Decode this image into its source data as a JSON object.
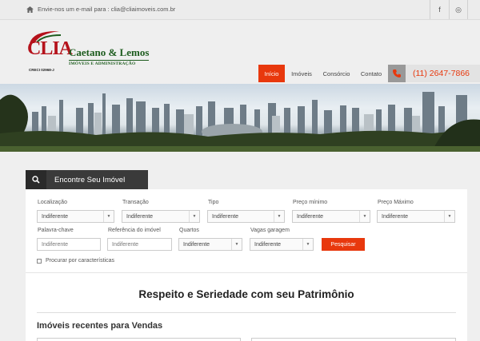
{
  "topbar": {
    "email_text": "Envie-nos um e-mail para : clia@cliaimoveis.com.br",
    "social": [
      {
        "icon": "facebook-icon",
        "glyph": "f"
      },
      {
        "icon": "instagram-icon",
        "glyph": "◎"
      }
    ]
  },
  "logo": {
    "word": "CLIA",
    "creci": "CRECI 02968-J"
  },
  "brand": {
    "name": "Caetano & Lemos",
    "tagline": "IMÓVEIS E ADMINISTRAÇÃO"
  },
  "nav": {
    "items": [
      "Início",
      "Imóveis",
      "Consórcio",
      "Contato"
    ],
    "active": "Início"
  },
  "phone": "(11) 2647-7866",
  "colors": {
    "accent": "#e8380d",
    "brand_green": "#1d5c1e",
    "logo_red": "#b5121b",
    "dark": "#3a3a3a"
  },
  "search": {
    "tab_label": "Encontre Seu Imóvel",
    "row1": [
      {
        "label": "Localização",
        "value": "Indiferente"
      },
      {
        "label": "Transação",
        "value": "Indiferente"
      },
      {
        "label": "Tipo",
        "value": "Indiferente"
      },
      {
        "label": "Preço mínimo",
        "value": "Indiferente"
      },
      {
        "label": "Preço Máximo",
        "value": "Indiferente"
      }
    ],
    "keyword": {
      "label": "Palavra-chave",
      "placeholder": "Indiferente"
    },
    "reference": {
      "label": "Referência do imóvel",
      "placeholder": "Indiferente"
    },
    "rooms": {
      "label": "Quartos",
      "value": "Indiferente"
    },
    "garage": {
      "label": "Vagas garagem",
      "value": "Indiferente"
    },
    "submit_label": "Pesquisar",
    "features_label": "Procurar por características"
  },
  "main": {
    "headline": "Respeito e Seriedade com seu Patrimônio",
    "recent_title": "Imóveis recentes para Vendas"
  }
}
